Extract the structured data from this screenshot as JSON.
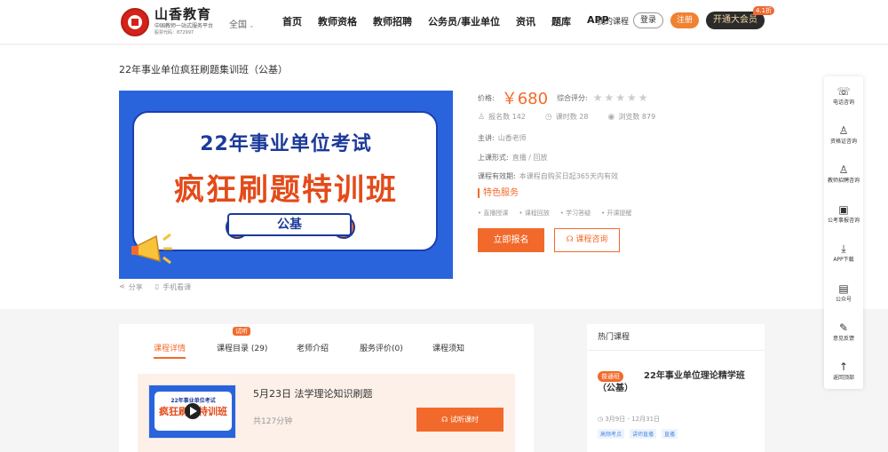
{
  "header": {
    "logo_name": "山香教育",
    "logo_sub": "中国教师一站式服务平台",
    "logo_code": "股票代码：872997",
    "region": "全国",
    "nav": [
      "首页",
      "教师资格",
      "教师招聘",
      "公务员/事业单位",
      "资讯",
      "题库",
      "APP"
    ],
    "my_course": "我的课程",
    "login": "登录",
    "register": "注册",
    "vip": "开通大会员",
    "vip_badge": "4.1折"
  },
  "course": {
    "title": "22年事业单位疯狂刷题集训班（公基）",
    "banner_line1": "22年事业单位考试",
    "banner_line2": "疯狂刷题特训班",
    "banner_tag": "公基",
    "share": "分享",
    "mobile": "手机看课",
    "price_label": "价格:",
    "price": "￥680",
    "rating_label": "综合评分:",
    "stars": "★★★★★",
    "stats": [
      {
        "icon": "user-icon",
        "text": "报名数 142"
      },
      {
        "icon": "clock-icon",
        "text": "课时数 28"
      },
      {
        "icon": "eye-icon",
        "text": "浏览数 879"
      }
    ],
    "lecturer_label": "主讲:",
    "lecturer": "山香老师",
    "format_label": "上课形式:",
    "format": "直播 / 回放",
    "validity_label": "课程有效期:",
    "validity": "本课程自购买日起365天内有效",
    "feature_title": "特色服务",
    "features": [
      "• 直播授课",
      "• 课程回放",
      "• 学习答疑",
      "• 开课提醒"
    ],
    "enroll": "立即报名",
    "consult": "课程咨询"
  },
  "float_bar": [
    {
      "icon": "phone-icon",
      "glyph": "☏",
      "label": "电话咨询"
    },
    {
      "icon": "person-icon",
      "glyph": "♙",
      "label": "资格证咨询"
    },
    {
      "icon": "person-icon",
      "glyph": "♙",
      "label": "教师招聘咨询"
    },
    {
      "icon": "doc-icon",
      "glyph": "▣",
      "label": "公考事报咨询"
    },
    {
      "icon": "download-icon",
      "glyph": "⤓",
      "label": "APP下载"
    },
    {
      "icon": "wechat-icon",
      "glyph": "▤",
      "label": "公众号"
    },
    {
      "icon": "pencil-icon",
      "glyph": "✎",
      "label": "意见反馈"
    },
    {
      "icon": "arrow-up-icon",
      "glyph": "↑",
      "label": "返回顶部"
    }
  ],
  "tabs": {
    "items": [
      "课程详情",
      "课程目录 (29)",
      "老师介绍",
      "服务评价(0)",
      "课程须知"
    ],
    "trial_badge": "试听"
  },
  "lesson": {
    "thumb_l1": "22年事业单位考试",
    "thumb_l2": "疯狂刷题特训班",
    "thumb_tag": "公基",
    "title": "5月23日 法学理论知识刷题",
    "duration": "共127分钟",
    "listen": "试听课时"
  },
  "hot": {
    "heading": "热门课程",
    "badge": "普通班",
    "title": "22年事业单位理论精学班（公基）",
    "date": "3月9日 - 12月31日",
    "tags": [
      "高频考点",
      "讲师直播",
      "直播"
    ]
  }
}
